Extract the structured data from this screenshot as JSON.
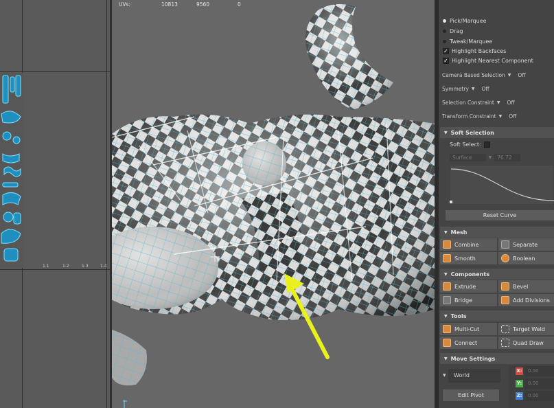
{
  "uv_hud": {
    "label": "UVs:",
    "values": [
      "10813",
      "9560",
      "0"
    ]
  },
  "uv_editor": {
    "ticks": [
      "1.1",
      "1.2",
      "1.3",
      "1.4"
    ]
  },
  "tool_settings": {
    "radios": [
      {
        "label": "Pick/Marquee",
        "selected": true
      },
      {
        "label": "Drag",
        "selected": false
      },
      {
        "label": "Tweak/Marquee",
        "selected": false
      }
    ],
    "checkboxes": [
      {
        "label": "Highlight Backfaces",
        "checked": true
      },
      {
        "label": "Highlight Nearest Component",
        "checked": true
      }
    ],
    "options": [
      {
        "label": "Camera Based Selection",
        "value": "Off"
      },
      {
        "label": "Symmetry",
        "value": "Off"
      },
      {
        "label": "Selection Constraint",
        "value": "Off"
      },
      {
        "label": "Transform Constraint",
        "value": "Off"
      }
    ]
  },
  "soft_selection": {
    "header": "Soft Selection",
    "soft_select_label": "Soft Select:",
    "falloff_mode": "Surface",
    "radius": "76.72",
    "reset_label": "Reset Curve"
  },
  "sections": {
    "mesh": "Mesh",
    "components": "Components",
    "tools": "Tools",
    "move_settings": "Move Settings"
  },
  "tools": {
    "combine": "Combine",
    "separate": "Separate",
    "smooth": "Smooth",
    "boolean": "Boolean",
    "extrude": "Extrude",
    "bevel": "Bevel",
    "bridge": "Bridge",
    "add_divisions": "Add Divisions",
    "multi_cut": "Multi-Cut",
    "target_weld": "Target Weld",
    "connect": "Connect",
    "quad_draw": "Quad Draw"
  },
  "move_settings": {
    "space": "World",
    "edit_pivot": "Edit Pivot",
    "axes": [
      {
        "label": "X:",
        "value": "0.00",
        "color": "#d9473d"
      },
      {
        "label": "Y:",
        "value": "0.00",
        "color": "#45b043"
      },
      {
        "label": "Z:",
        "value": "0.00",
        "color": "#3d7fd9"
      }
    ]
  },
  "colors": {
    "annotation_arrow": "#e8f01e",
    "wireframe": "#4fb8d8"
  }
}
